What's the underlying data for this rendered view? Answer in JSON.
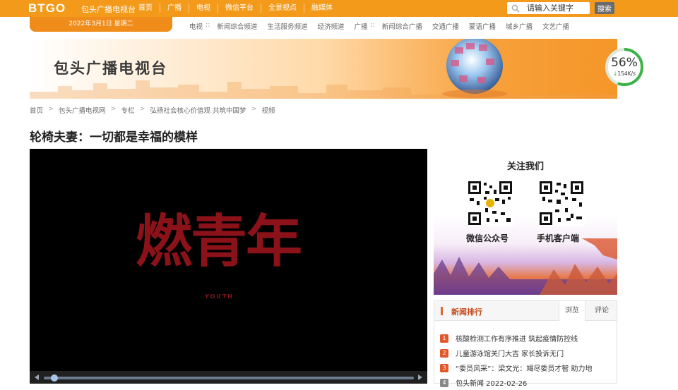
{
  "topbar": {
    "logo": "BTGO",
    "site_name": "包头广播电视台",
    "nav": [
      "首页",
      "广播",
      "电视",
      "微信平台",
      "全景视点",
      "融媒体"
    ],
    "search_placeholder": "请输入关键字",
    "search_button": "搜索",
    "brand_color": "#f49a1a"
  },
  "datebar": {
    "text": "2022年3月1日  星期二"
  },
  "subnav": [
    {
      "label": "电视",
      "sep": true
    },
    {
      "label": "新闻综合频道"
    },
    {
      "label": "生活服务频道"
    },
    {
      "label": "经济频道"
    },
    {
      "label": "广播",
      "sep": true
    },
    {
      "label": "新闻综合广播"
    },
    {
      "label": "交通广播"
    },
    {
      "label": "蒙语广播"
    },
    {
      "label": "城乡广播"
    },
    {
      "label": "文艺广播"
    }
  ],
  "banner": {
    "title": "包头广播电视台"
  },
  "speed_widget": {
    "percent": "56%",
    "rate": "154K/s",
    "level": 0.56
  },
  "breadcrumb": [
    "首页",
    "包头广播电视网",
    "专栏",
    "弘扬社会核心价值观 共筑中国梦",
    "视频"
  ],
  "article": {
    "title": "轮椅夫妻：一切都是幸福的模样"
  },
  "video": {
    "logo_text": "燃青年",
    "logo_sub": "YOUTH",
    "progress": 0.02
  },
  "follow": {
    "title": "关注我们",
    "qr": [
      {
        "label": "微信公众号"
      },
      {
        "label": "手机客户端"
      }
    ]
  },
  "news": {
    "title": "新闻排行",
    "tabs": [
      "浏览",
      "评论"
    ],
    "items": [
      {
        "rank": "1",
        "text": "核酸检测工作有序推进 筑起疫情防控线"
      },
      {
        "rank": "2",
        "text": "儿童游泳馆关门大吉 家长投诉无门"
      },
      {
        "rank": "3",
        "text": "“委员风采”：梁文光：竭尽委员才智 助力地"
      },
      {
        "rank": "4",
        "text": "包头新闻 2022-02-26"
      }
    ]
  }
}
